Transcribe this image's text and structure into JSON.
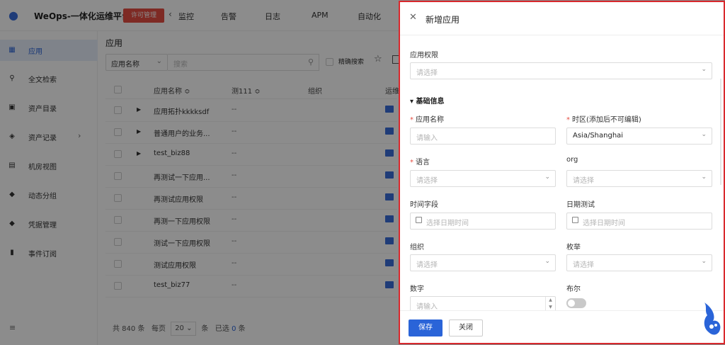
{
  "app": {
    "brand": "WeOps-一体化运维平台",
    "license_button": "许可管理",
    "nav": [
      "监控",
      "告警",
      "日志",
      "APM",
      "自动化"
    ]
  },
  "sidebar": {
    "items": [
      {
        "label": "应用",
        "icon": "grid-icon",
        "active": true
      },
      {
        "label": "全文检索",
        "icon": "search-user-icon"
      },
      {
        "label": "资产目录",
        "icon": "catalog-icon"
      },
      {
        "label": "资产记录",
        "icon": "layers-icon"
      },
      {
        "label": "机房视图",
        "icon": "server-icon"
      },
      {
        "label": "动态分组",
        "icon": "shield-icon"
      },
      {
        "label": "凭据管理",
        "icon": "key-icon"
      },
      {
        "label": "事件订阅",
        "icon": "bookmark-icon"
      }
    ]
  },
  "main": {
    "title": "应用",
    "filter_field": "应用名称",
    "search_placeholder": "搜索",
    "exact_search": "精确搜索",
    "columns": [
      "应用名称 ≎",
      "测111 ≎",
      "组织",
      "运维"
    ],
    "rows": [
      {
        "name": "应用拓扑kkkksdf",
        "val": "--",
        "expandable": true
      },
      {
        "name": "普通用户的业务...",
        "val": "--",
        "expandable": true
      },
      {
        "name": "test_biz88",
        "val": "--",
        "expandable": true
      },
      {
        "name": "再测试一下应用...",
        "val": "--"
      },
      {
        "name": "再测试应用权限",
        "val": "--"
      },
      {
        "name": "再测一下应用权限",
        "val": "--"
      },
      {
        "name": "测试一下应用权限",
        "val": "--"
      },
      {
        "name": "测试应用权限",
        "val": "--"
      },
      {
        "name": "test_biz77",
        "val": "--"
      }
    ],
    "pager": {
      "total": "共 840 条",
      "per_page": "每页",
      "page_size": "20",
      "unit": "条",
      "selected_prefix": "已选",
      "selected_count": "0",
      "selected_unit": "条"
    }
  },
  "drawer": {
    "title": "新增应用",
    "permission_label": "应用权限",
    "permission_placeholder": "请选择",
    "section": "基础信息",
    "app_name_label": "应用名称",
    "app_name_placeholder": "请输入",
    "timezone_label": "时区(添加后不可编辑)",
    "timezone_value": "Asia/Shanghai",
    "language_label": "语言",
    "language_placeholder": "请选择",
    "org_label": "org",
    "org_placeholder": "请选择",
    "time_field_label": "时间字段",
    "time_field_placeholder": "选择日期时间",
    "date_test_label": "日期测试",
    "date_test_placeholder": "选择日期时间",
    "group_label": "组织",
    "group_placeholder": "请选择",
    "enum_label": "枚举",
    "enum_placeholder": "请选择",
    "number_label": "数字",
    "number_placeholder": "请输入",
    "bool_label": "布尔",
    "bool_value": false,
    "save": "保存",
    "close": "关闭"
  },
  "colors": {
    "primary": "#2a64d8",
    "danger": "#e54d42",
    "highlight_border": "#d9282d"
  }
}
